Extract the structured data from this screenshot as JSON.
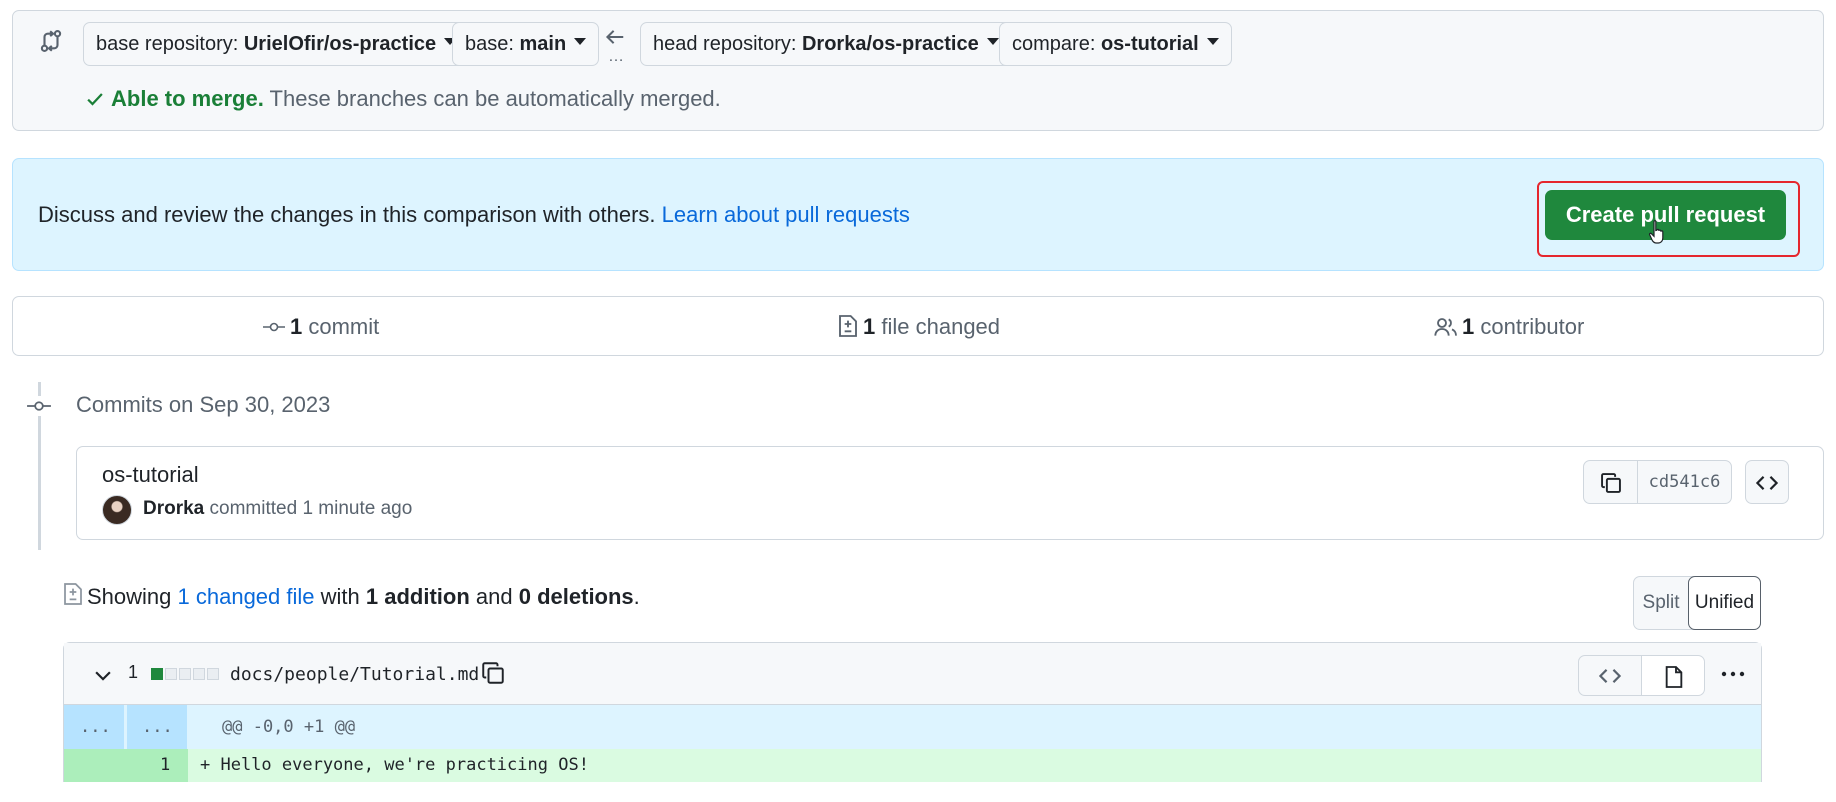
{
  "range": {
    "base_repo_label": "base repository: ",
    "base_repo_value": "UrielOfir/os-practice",
    "base_label": "base: ",
    "base_value": "main",
    "head_repo_label": "head repository: ",
    "head_repo_value": "Drorka/os-practice",
    "compare_label": "compare: ",
    "compare_value": "os-tutorial",
    "merge_status": "Able to merge.",
    "merge_note": "These branches can be automatically merged."
  },
  "blankslate": {
    "text": "Discuss and review the changes in this comparison with others. ",
    "link": "Learn about pull requests",
    "cta": "Create pull request"
  },
  "stats": {
    "commits_count": "1",
    "commits_label": "commit",
    "files_count": "1",
    "files_label": "file changed",
    "contributors_count": "1",
    "contributors_label": "contributor"
  },
  "commits": {
    "date_heading": "Commits on Sep 30, 2023",
    "title": "os-tutorial",
    "author": "Drorka",
    "meta": "committed 1 minute ago",
    "sha": "cd541c6"
  },
  "summary": {
    "prefix": "Showing ",
    "changed_files": "1 changed file",
    "with": "with",
    "additions": "1 addition",
    "and": "and",
    "deletions": "0 deletions",
    "period": "."
  },
  "view_toggle": {
    "split": "Split",
    "unified": "Unified"
  },
  "diff": {
    "change_count": "1",
    "path": "docs/people/Tutorial.md",
    "hunk_left": "...",
    "hunk_right": "...",
    "hunk_header": "@@ -0,0 +1 @@",
    "line_number": "1",
    "line_text": "+ Hello everyone, we're practicing OS!"
  },
  "colors": {
    "accent": "#0969da",
    "success": "#1f883d",
    "highlight": "#e5262e"
  },
  "icons": [
    "git-compare-icon",
    "arrow-left-icon",
    "check-icon",
    "commit-icon",
    "file-diff-icon",
    "people-icon",
    "copy-icon",
    "code-icon",
    "chevron-down-icon",
    "file-icon",
    "kebab-icon",
    "cursor-hand-icon"
  ]
}
